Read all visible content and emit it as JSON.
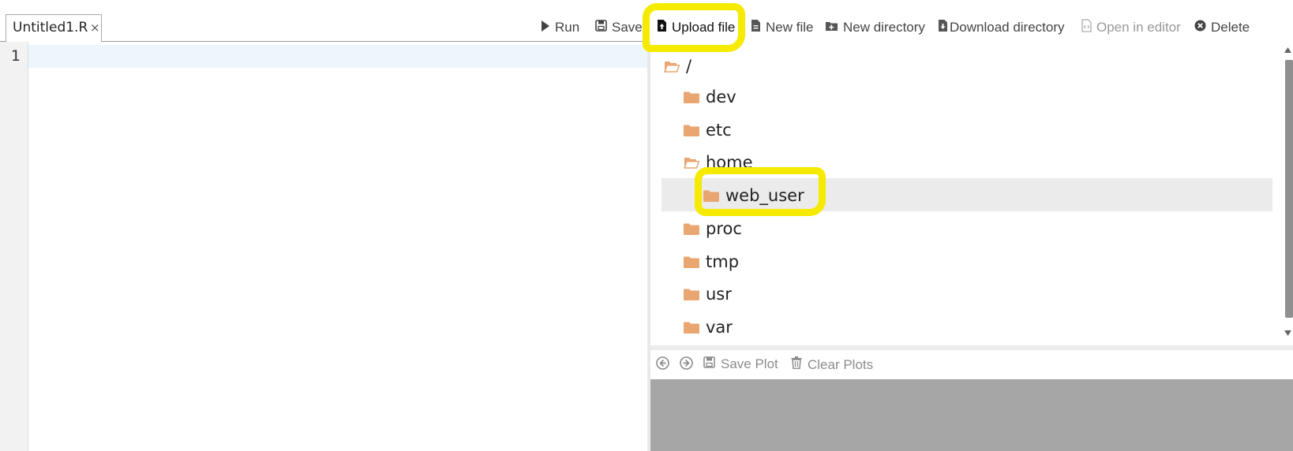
{
  "editor": {
    "tab_label": "Untitled1.R",
    "tab_close": "×",
    "line_number": "1"
  },
  "toolbar": {
    "run": "Run",
    "save": "Save",
    "upload_file": "Upload file",
    "new_file": "New file",
    "new_directory": "New directory",
    "download_directory": "Download directory",
    "open_in_editor": "Open in editor",
    "delete": "Delete"
  },
  "file_tree": {
    "root": "/",
    "items": [
      {
        "name": "dev"
      },
      {
        "name": "etc"
      },
      {
        "name": "home"
      },
      {
        "name": "web_user"
      },
      {
        "name": "proc"
      },
      {
        "name": "tmp"
      },
      {
        "name": "usr"
      },
      {
        "name": "var"
      }
    ],
    "selected": "web_user"
  },
  "plot_toolbar": {
    "save_plot": "Save Plot",
    "clear_plots": "Clear Plots"
  },
  "colors": {
    "folder": "#e9a671",
    "highlight": "#f5ea00",
    "plot_bg": "#a6a6a6"
  }
}
